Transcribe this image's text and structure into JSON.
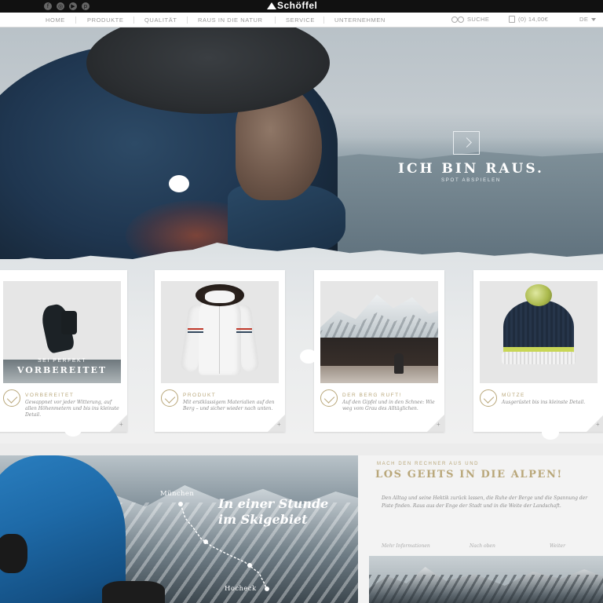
{
  "brand": {
    "name": "Schöffel"
  },
  "social": [
    {
      "icon": "facebook-icon",
      "glyph": "f"
    },
    {
      "icon": "instagram-icon",
      "glyph": "◎"
    },
    {
      "icon": "youtube-icon",
      "glyph": "▶"
    },
    {
      "icon": "pinterest-icon",
      "glyph": "p"
    }
  ],
  "nav": {
    "items": [
      "HOME",
      "PRODUKTE",
      "QUALITÄT",
      "RAUS IN DIE NATUR",
      "SERVICE",
      "UNTERNEHMEN"
    ],
    "search_label": "SUCHE",
    "cart_label": "(0) 14,00€",
    "language": "DE"
  },
  "hero": {
    "headline": "ICH BIN RAUS.",
    "subline": "SPOT ABSPIELEN"
  },
  "cards": [
    {
      "overlay_small": "SEI PERFEKT",
      "overlay_big": "VORBEREITET",
      "title": "VORBEREITET",
      "text": "Gewappnet vor jeder Witterung, auf allen Höhenmetern und bis ins kleinste Detail."
    },
    {
      "title": "PRODUKT",
      "text": "Mit erstklassigem Materialien auf den Berg – und sicher wieder nach unten."
    },
    {
      "title": "DER BERG RUFT!",
      "text": "Auf den Gipfel und in den Schnee: Wie weg vom Grau des Alltäglichen."
    },
    {
      "title": "MÜTZE",
      "text": "Ausgerüstet bis ins kleinste Detail."
    }
  ],
  "map": {
    "city_start": "München",
    "city_end": "Hocheck",
    "headline_line1": "In einer Stunde",
    "headline_line2": "im Skigebiet"
  },
  "alps": {
    "kicker": "MACH DEN RECHNER AUS UND",
    "title": "LOS GEHTS IN DIE ALPEN!",
    "text": "Den Alltag und seine Hektik zurück lassen, die Ruhe der Berge und die Spannung der Piste finden. Raus aus der Enge der Stadt und in die Weite der Landschaft.",
    "links": [
      "Mehr Informationen",
      "Nach oben",
      "Weiter"
    ]
  },
  "colors": {
    "accent_gold": "#b9a77a",
    "topbar": "#111111",
    "jacket_blue": "#1e6aa8"
  }
}
